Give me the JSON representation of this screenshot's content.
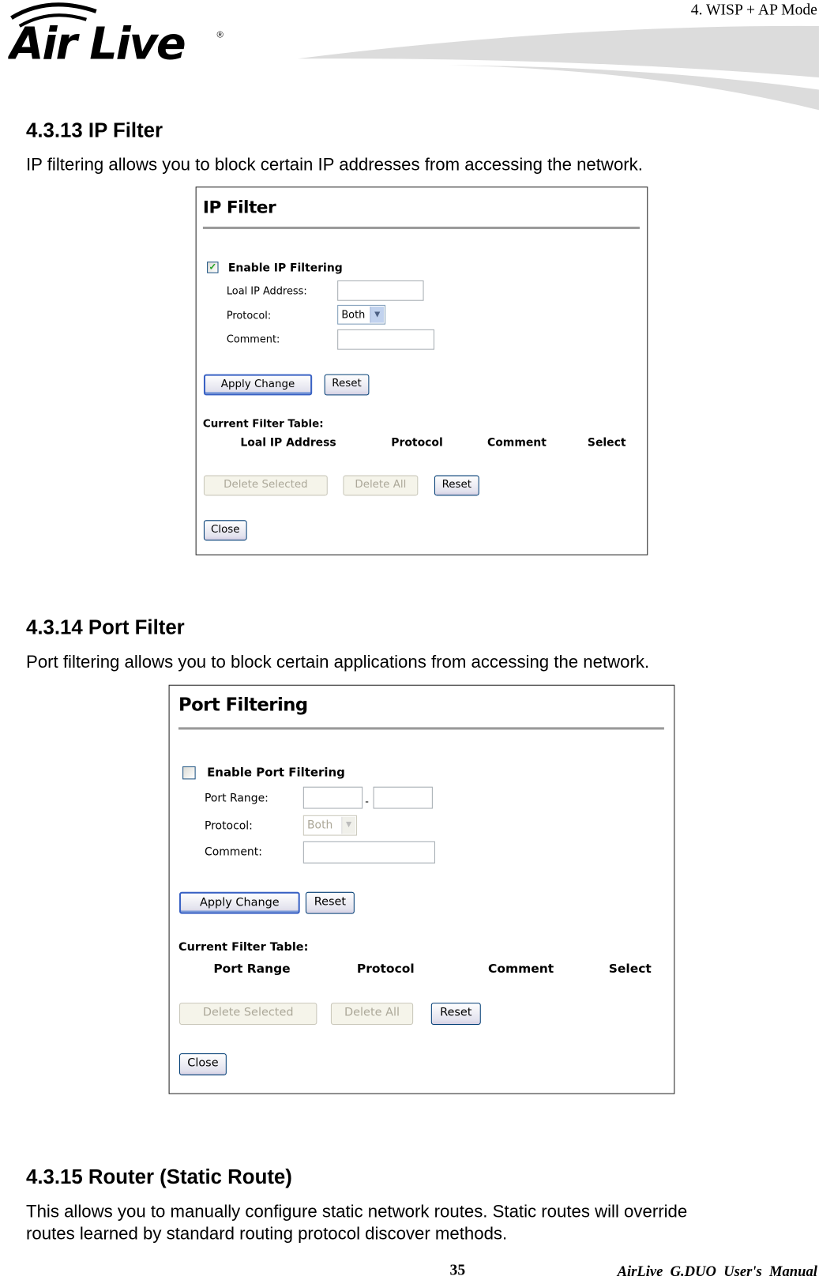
{
  "header": {
    "chapter": "4.  WISP  +  AP  Mode",
    "logo_text": "Air Live"
  },
  "sections": [
    {
      "heading": "4.3.13 IP Filter",
      "text": "IP filtering allows you to block certain IP addresses from accessing the network."
    },
    {
      "heading": "4.3.14 Port Filter",
      "text": "Port filtering allows you to block certain applications from accessing the network."
    },
    {
      "heading": "4.3.15 Router (Static Route)",
      "text_lines": [
        "This allows you to manually configure static network routes. Static routes will override",
        "routes learned by standard routing protocol discover methods."
      ]
    }
  ],
  "ip_filter": {
    "title": "IP Filter",
    "enable_label": "Enable IP Filtering",
    "enable_checked": true,
    "fields": {
      "local_ip_label": "Loal IP Address:",
      "local_ip_value": "",
      "protocol_label": "Protocol:",
      "protocol_value": "Both",
      "comment_label": "Comment:",
      "comment_value": ""
    },
    "apply_label": "Apply Change",
    "reset_label": "Reset",
    "table_title": "Current Filter Table:",
    "columns": [
      "Loal IP Address",
      "Protocol",
      "Comment",
      "Select"
    ],
    "delete_selected_label": "Delete Selected",
    "delete_all_label": "Delete All",
    "reset2_label": "Reset",
    "close_label": "Close"
  },
  "port_filter": {
    "title": "Port Filtering",
    "enable_label": "Enable Port Filtering",
    "enable_checked": false,
    "fields": {
      "port_range_label": "Port Range:",
      "port_from_value": "",
      "separator": "-",
      "port_to_value": "",
      "protocol_label": "Protocol:",
      "protocol_value": "Both",
      "comment_label": "Comment:",
      "comment_value": ""
    },
    "apply_label": "Apply Change",
    "reset_label": "Reset",
    "table_title": "Current Filter Table:",
    "columns": [
      "Port Range",
      "Protocol",
      "Comment",
      "Select"
    ],
    "delete_selected_label": "Delete Selected",
    "delete_all_label": "Delete All",
    "reset2_label": "Reset",
    "close_label": "Close"
  },
  "footer": {
    "page_number": "35",
    "manual_title": "AirLive  G.DUO  User's  Manual"
  }
}
